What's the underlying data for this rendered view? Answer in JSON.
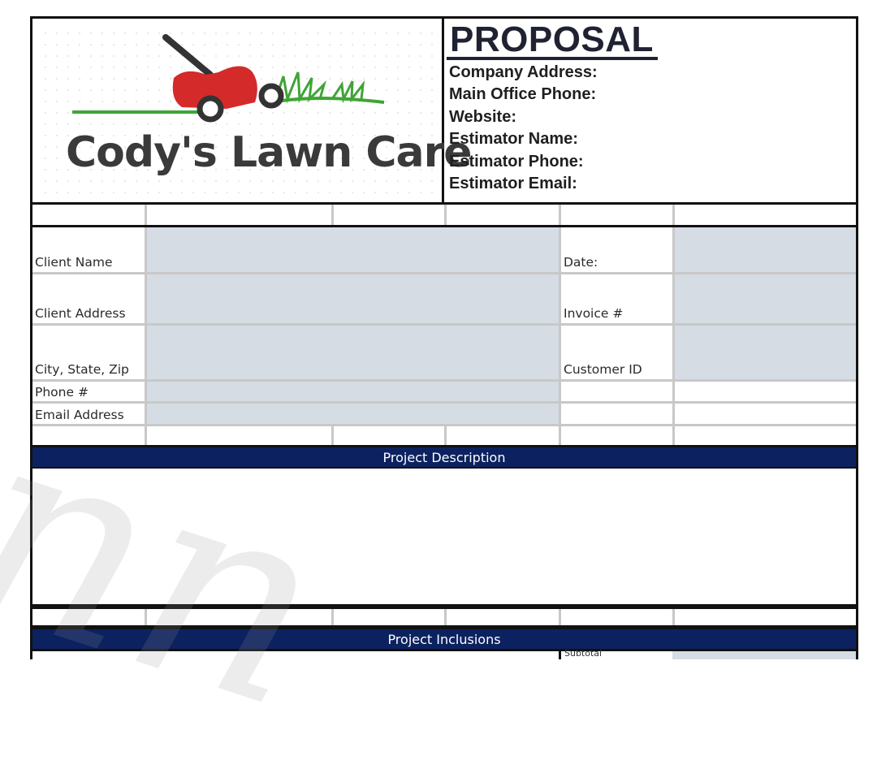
{
  "header": {
    "company_name": "Cody's Lawn Care",
    "logo_icon": "lawn-mower-icon",
    "document_title": "PROPOSAL",
    "info_fields": [
      "Company Address:",
      "Main Office Phone:",
      "Website:",
      "Estimator Name:",
      "Estimator Phone:",
      "Estimator Email:"
    ]
  },
  "client_info": {
    "left_labels": {
      "client_name": "Client Name",
      "client_address": "Client Address",
      "city_state_zip": "City, State, Zip",
      "phone": "Phone #",
      "email": "Email Address"
    },
    "right_labels": {
      "date": "Date:",
      "invoice": "Invoice #",
      "customer_id": "Customer ID"
    },
    "values": {
      "client_name": "",
      "client_address": "",
      "city_state_zip": "",
      "phone": "",
      "email": "",
      "date": "",
      "invoice": "",
      "customer_id": ""
    }
  },
  "sections": {
    "project_description": "Project Description",
    "project_description_value": "",
    "project_inclusions": "Project Inclusions",
    "subtotal_label": "Subtotal"
  },
  "colors": {
    "section_band": "#0c2260",
    "input_shade": "#d6dce4",
    "logo_red": "#d42a2a",
    "logo_green": "#3fa535"
  }
}
